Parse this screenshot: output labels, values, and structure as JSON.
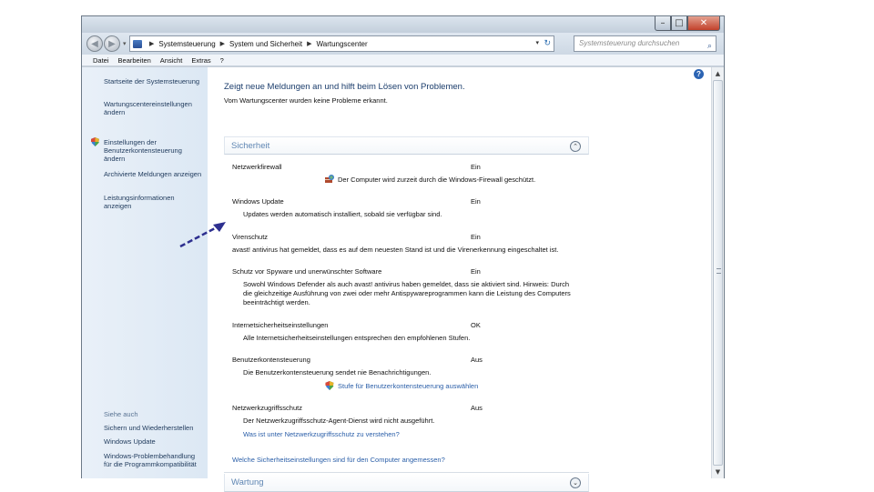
{
  "window": {
    "minimize": "–",
    "maximize": "□",
    "close": "✕"
  },
  "navbar": {
    "back": "◀",
    "forward": "▶",
    "recent": "▾",
    "breadcrumb": [
      "Systemsteuerung",
      "System und Sicherheit",
      "Wartungscenter"
    ],
    "dropdown": "▾",
    "refresh": "↻",
    "search_placeholder": "Systemsteuerung durchsuchen"
  },
  "menubar": [
    "Datei",
    "Bearbeiten",
    "Ansicht",
    "Extras",
    "?"
  ],
  "sidebar": {
    "home": "Startseite der Systemsteuerung",
    "items": [
      "Wartungscentereinstellungen ändern",
      "Einstellungen der Benutzerkontensteuerung ändern",
      "Archivierte Meldungen anzeigen",
      "Leistungsinformationen anzeigen"
    ],
    "see_also_header": "Siehe auch",
    "see_also": [
      "Sichern und Wiederherstellen",
      "Windows Update",
      "Windows-Problembehandlung für die Programmkompatibilität"
    ]
  },
  "main": {
    "help": "?",
    "headline": "Zeigt neue Meldungen an und hilft beim Lösen von Problemen.",
    "subline": "Vom Wartungscenter wurden keine Probleme erkannt.",
    "security": {
      "header": "Sicherheit",
      "toggle": "⌃",
      "items": [
        {
          "title": "Netzwerkfirewall",
          "state": "Ein",
          "desc": "Der Computer wird zurzeit durch die Windows-Firewall geschützt."
        },
        {
          "title": "Windows Update",
          "state": "Ein",
          "desc": "Updates werden automatisch installiert, sobald sie verfügbar sind."
        },
        {
          "title": "Virenschutz",
          "state": "Ein",
          "desc": "avast! antivirus hat gemeldet, dass es auf dem neuesten Stand ist und die Virenerkennung eingeschaltet ist."
        },
        {
          "title": "Schutz vor Spyware und unerwünschter Software",
          "state": "Ein",
          "desc": "Sowohl Windows Defender als auch avast! antivirus haben gemeldet, dass sie aktiviert sind. Hinweis: Durch die gleichzeitige Ausführung von zwei oder mehr Antispywareprogrammen kann die Leistung des Computers beeinträchtigt werden."
        },
        {
          "title": "Internetsicherheitseinstellungen",
          "state": "OK",
          "desc": "Alle Internetsicherheitseinstellungen entsprechen den empfohlenen Stufen."
        },
        {
          "title": "Benutzerkontensteuerung",
          "state": "Aus",
          "desc": "Die Benutzerkontensteuerung sendet nie Benachrichtigungen.",
          "link": "Stufe für Benutzerkontensteuerung auswählen"
        },
        {
          "title": "Netzwerkzugriffsschutz",
          "state": "Aus",
          "desc": "Der Netzwerkzugriffsschutz-Agent-Dienst wird nicht ausgeführt.",
          "link": "Was ist unter Netzwerkzugriffsschutz zu verstehen?"
        }
      ],
      "bottom_link": "Welche Sicherheitseinstellungen sind für den Computer angemessen?"
    },
    "maintenance": {
      "header": "Wartung",
      "toggle": "⌄"
    }
  },
  "scrollbar": {
    "up": "▲",
    "down": "▼"
  }
}
